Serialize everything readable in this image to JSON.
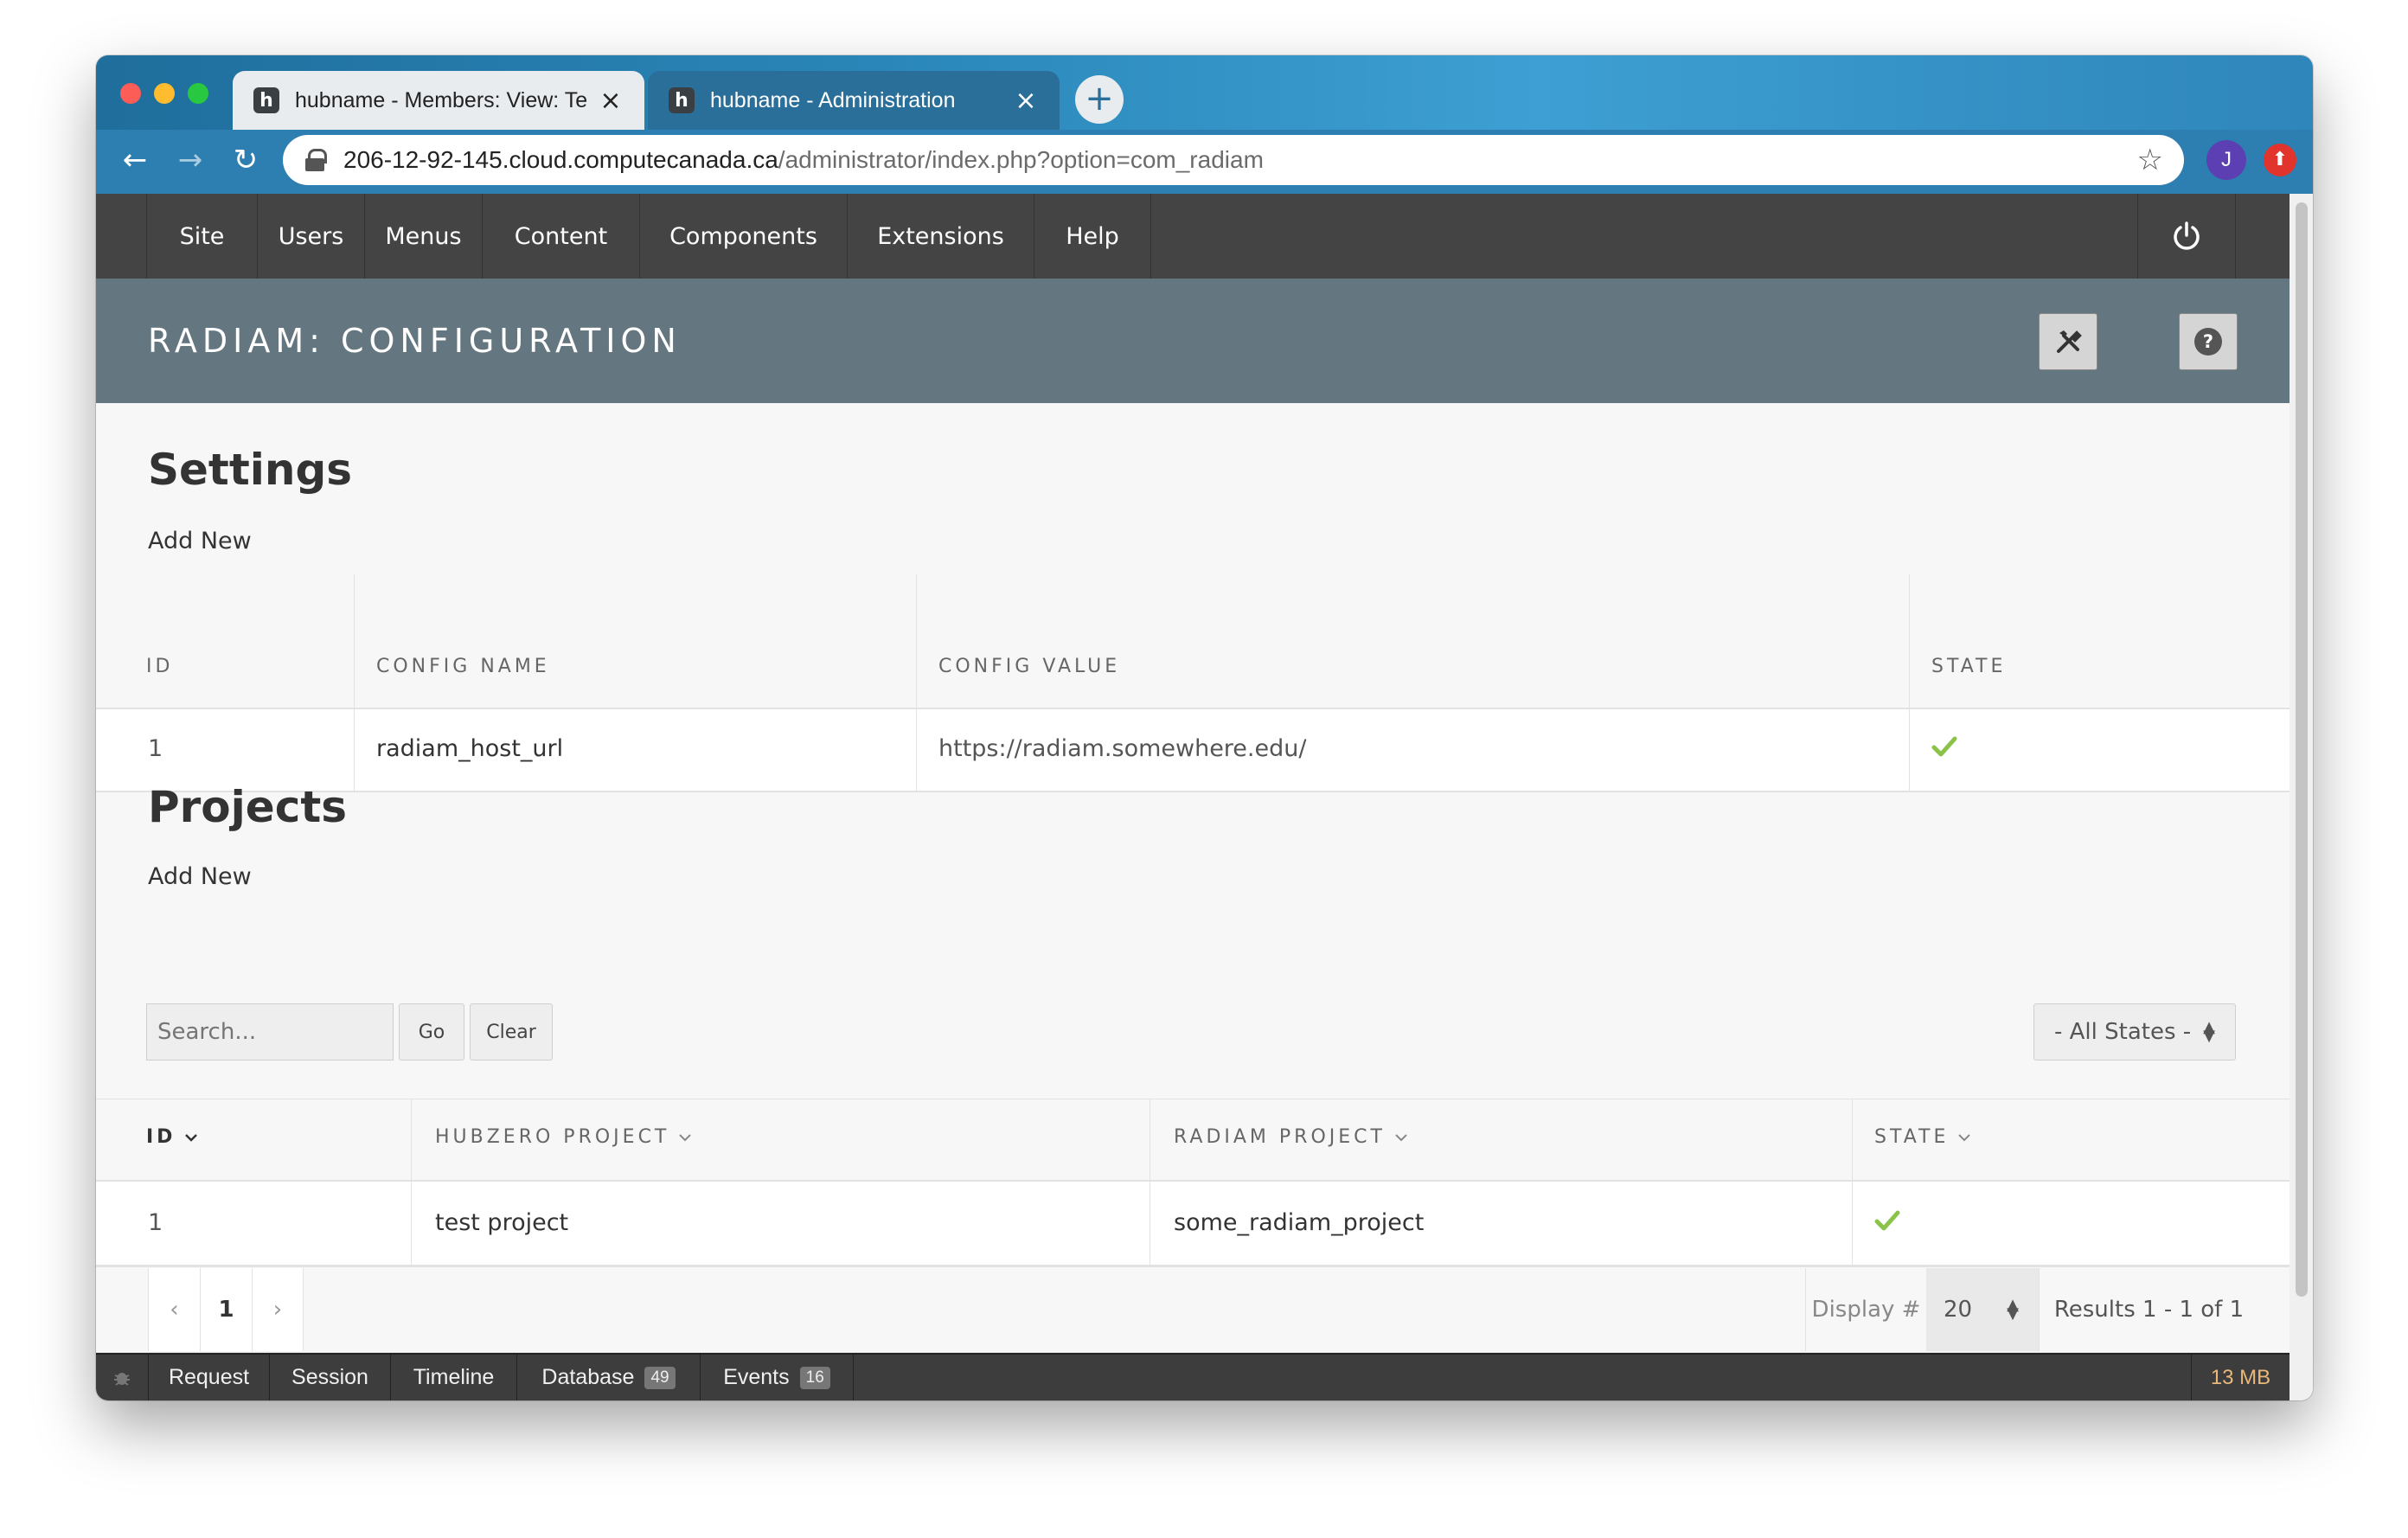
{
  "browser": {
    "tabs": [
      {
        "title": "hubname - Members: View: Te",
        "active": true
      },
      {
        "title": "hubname - Administration",
        "active": false
      }
    ],
    "new_tab": "+",
    "url_host": "206-12-92-145.cloud.computecanada.ca",
    "url_path": "/administrator/index.php?option=com_radiam",
    "profile_initial": "J",
    "favicon_letter": "h"
  },
  "menu": {
    "items": [
      "Site",
      "Users",
      "Menus",
      "Content",
      "Components",
      "Extensions",
      "Help"
    ]
  },
  "header": {
    "title": "RADIAM: CONFIGURATION"
  },
  "settings": {
    "title": "Settings",
    "add_new": "Add New",
    "columns": [
      "ID",
      "CONFIG NAME",
      "CONFIG VALUE",
      "STATE"
    ],
    "rows": [
      {
        "id": "1",
        "name": "radiam_host_url",
        "value": "https://radiam.somewhere.edu/",
        "state": "published"
      }
    ]
  },
  "projects": {
    "title": "Projects",
    "add_new": "Add New",
    "search_placeholder": "Search...",
    "go_label": "Go",
    "clear_label": "Clear",
    "states_filter": "- All States -",
    "columns": [
      "ID",
      "HUBZERO PROJECT",
      "RADIAM PROJECT",
      "STATE"
    ],
    "rows": [
      {
        "id": "1",
        "hubzero_project": "test project",
        "radiam_project": "some_radiam_project",
        "state": "published"
      }
    ],
    "pagination": {
      "prev": "‹",
      "current_page": "1",
      "next": "›"
    },
    "display_label": "Display #",
    "display_value": "20",
    "results": "Results 1 - 1 of 1"
  },
  "debugbar": {
    "items": [
      {
        "label": "Request"
      },
      {
        "label": "Session"
      },
      {
        "label": "Timeline"
      },
      {
        "label": "Database",
        "badge": "49"
      },
      {
        "label": "Events",
        "badge": "16"
      }
    ],
    "memory": "13 MB"
  },
  "colors": {
    "menu_bg": "#444444",
    "header_bg": "#647680",
    "check_green": "#8bc34a",
    "chrome_blue": "#2c7fb0"
  }
}
